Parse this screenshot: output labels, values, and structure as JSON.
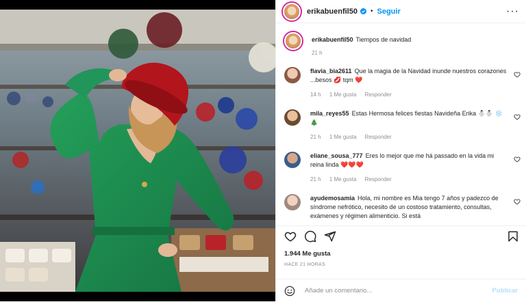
{
  "post": {
    "username": "erikabuenfil50",
    "follow_label": "Seguir",
    "caption": "Tiempos de navidad",
    "caption_time": "21 h",
    "likes": "1.944 Me gusta",
    "posted_ago": "HACE 21 HORAS"
  },
  "comments": [
    {
      "user": "flavia_bia2611",
      "text": "Que la magia de la Navidad inunde nuestros corazones ...besos 💋 tqm ❤️",
      "time": "14 h",
      "likes": "1 Me gusta",
      "reply": "Responder"
    },
    {
      "user": "mila_reyes55",
      "text": "Estas Hermosa felices fiestas Navideña Erika ⛄⛄ ❄️🎄",
      "time": "21 h",
      "likes": "1 Me gusta",
      "reply": "Responder"
    },
    {
      "user": "eliane_sousa_777",
      "text": "Eres lo mejor que me há passado en la vida mi reina linda ❤️❤️❤️",
      "time": "21 h",
      "likes": "1 Me gusta",
      "reply": "Responder"
    },
    {
      "user": "ayudemosamia",
      "text": "Hola, mi nombre es Mia tengo 7 años y padezco de síndrome nefrótico, necesito de un costoso tratamiento, consultas, exámenes y régimen alimenticio. Si está",
      "time": "",
      "likes": "",
      "reply": ""
    }
  ],
  "composer": {
    "placeholder": "Añade un comentario...",
    "publish_label": "Publicar"
  },
  "icons": {
    "verified": "verified-badge-icon",
    "more": "more-options-icon",
    "like": "heart-icon",
    "comment": "comment-icon",
    "share": "share-icon",
    "save": "bookmark-icon",
    "emoji": "emoji-icon"
  },
  "colors": {
    "accent": "#0095f6",
    "dress": "#1f8a4c",
    "hat": "#b3151c",
    "heart": "#ed4956"
  }
}
